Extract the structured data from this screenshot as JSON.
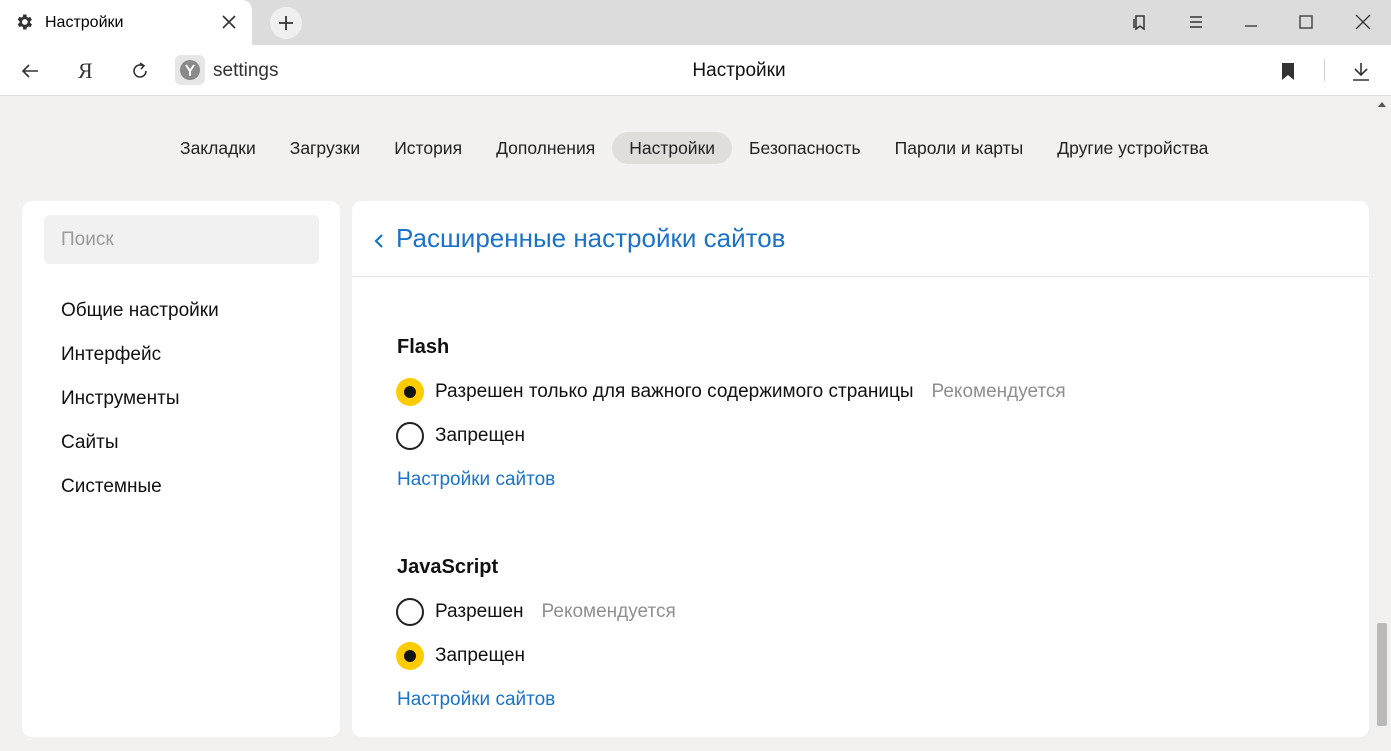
{
  "browser": {
    "tab_title": "Настройки",
    "url": "settings",
    "page_title": "Настройки",
    "ya_letter": "Я",
    "icons": {
      "tab": "gear-icon",
      "close": "close-icon",
      "new_tab": "plus-icon",
      "collections": "collections-icon",
      "menu": "hamburger-menu-icon",
      "minimize": "minimize-icon",
      "maximize": "maximize-icon",
      "window_close": "window-close-icon",
      "back": "back-arrow-icon",
      "reload": "reload-icon",
      "bookmark": "bookmark-icon",
      "download": "download-icon"
    }
  },
  "topnav": {
    "items": [
      {
        "label": "Закладки"
      },
      {
        "label": "Загрузки"
      },
      {
        "label": "История"
      },
      {
        "label": "Дополнения"
      },
      {
        "label": "Настройки",
        "active": true
      },
      {
        "label": "Безопасность"
      },
      {
        "label": "Пароли и карты"
      },
      {
        "label": "Другие устройства"
      }
    ]
  },
  "sidebar": {
    "search_placeholder": "Поиск",
    "items": [
      {
        "label": "Общие настройки"
      },
      {
        "label": "Интерфейс"
      },
      {
        "label": "Инструменты"
      },
      {
        "label": "Сайты"
      },
      {
        "label": "Системные"
      }
    ]
  },
  "main": {
    "heading": "Расширенные настройки сайтов",
    "sections": [
      {
        "title": "Flash",
        "options": [
          {
            "label": "Разрешен только для важного содержимого страницы",
            "hint": "Рекомендуется",
            "checked": true
          },
          {
            "label": "Запрещен",
            "hint": "",
            "checked": false
          }
        ],
        "link": "Настройки сайтов"
      },
      {
        "title": "JavaScript",
        "options": [
          {
            "label": "Разрешен",
            "hint": "Рекомендуется",
            "checked": false
          },
          {
            "label": "Запрещен",
            "hint": "",
            "checked": true
          }
        ],
        "link": "Настройки сайтов"
      }
    ]
  },
  "colors": {
    "accent_link": "#1a73c9",
    "radio_checked": "#ffcc00",
    "page_bg": "#f2f1ef"
  }
}
